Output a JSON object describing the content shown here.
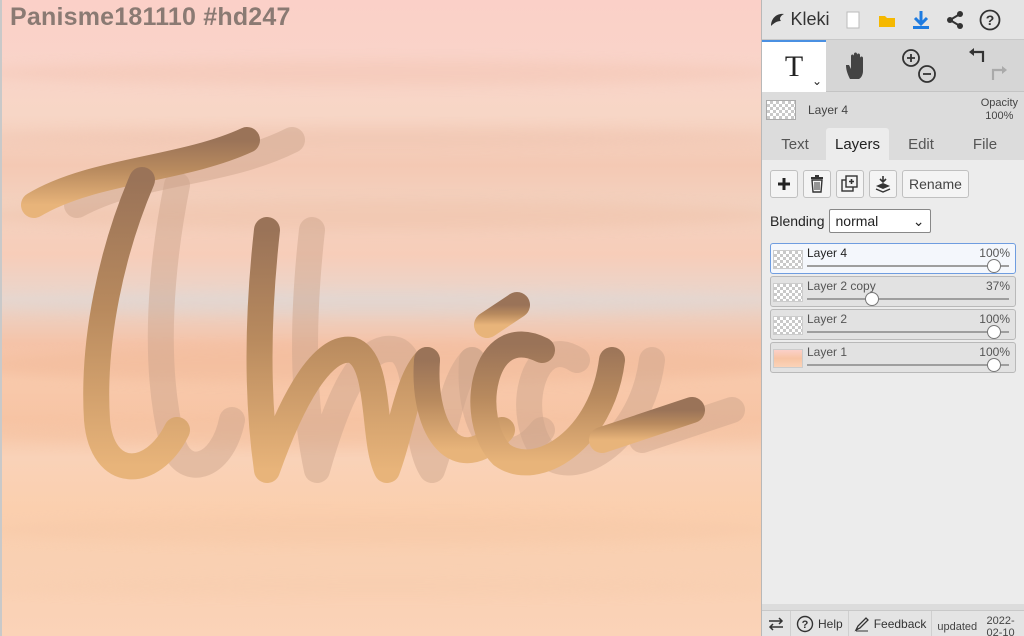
{
  "canvas": {
    "title": "Panisme181110 #hd247",
    "artwork_alt": "Handwritten lettering with faded offset copies"
  },
  "topbar": {
    "app_name": "Kleki",
    "icons": [
      "kleki-logo-icon",
      "new-image-icon",
      "open-folder-icon",
      "download-icon",
      "share-icon",
      "help-icon"
    ]
  },
  "tools": {
    "text_tool": "T",
    "icons": [
      "text-tool-icon",
      "hand-tool-icon",
      "zoom-in-icon",
      "zoom-out-icon",
      "undo-icon",
      "redo-icon"
    ]
  },
  "current_layer": {
    "name": "Layer 4",
    "opacity_label": "Opacity",
    "opacity_value": "100%"
  },
  "tabs": [
    {
      "label": "Text",
      "active": false
    },
    {
      "label": "Layers",
      "active": true
    },
    {
      "label": "Edit",
      "active": false
    },
    {
      "label": "File",
      "active": false
    }
  ],
  "layer_actions": {
    "icons": [
      "add-layer-icon",
      "delete-layer-icon",
      "duplicate-layer-icon",
      "merge-down-icon"
    ],
    "rename_label": "Rename"
  },
  "blending": {
    "label": "Blending",
    "selected": "normal"
  },
  "layers": [
    {
      "name": "Layer 4",
      "opacity": "100%",
      "opacity_fraction": 1.0,
      "selected": true,
      "thumb": "transparent"
    },
    {
      "name": "Layer 2 copy",
      "opacity": "37%",
      "opacity_fraction": 0.37,
      "selected": false,
      "thumb": "lettering"
    },
    {
      "name": "Layer 2",
      "opacity": "100%",
      "opacity_fraction": 1.0,
      "selected": false,
      "thumb": "lettering"
    },
    {
      "name": "Layer 1",
      "opacity": "100%",
      "opacity_fraction": 1.0,
      "selected": false,
      "thumb": "sky"
    }
  ],
  "bottombar": {
    "help_label": "Help",
    "feedback_label": "Feedback",
    "updated_label": "updated",
    "updated_date": "2022-02-10"
  },
  "colors": {
    "accent": "#4a90e2",
    "download": "#1e7be0",
    "folder": "#f5b800",
    "lettering": "#c08a50"
  }
}
